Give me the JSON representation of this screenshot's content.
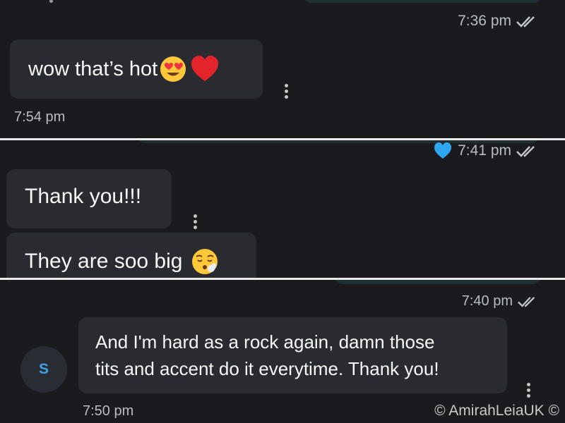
{
  "panel1": {
    "sent_time": "7:36 pm",
    "message": "wow that’s hot",
    "emoji_names": [
      "heart-eyes-emoji",
      "red-heart-emoji"
    ],
    "received_time": "7:54 pm"
  },
  "panel2": {
    "sent_time": "7:41 pm",
    "reaction": "blue-heart-icon",
    "messages": [
      "Thank you!!!",
      "They are soo big"
    ],
    "emoji_names": [
      "exhaling-face-emoji"
    ]
  },
  "panel3": {
    "sent_time": "7:40 pm",
    "message_line1": "And I'm hard as a rock again, damn those",
    "message_line2": "tits and accent do it everytime. Thank you!",
    "avatar_letter": "S",
    "received_time": "7:50 pm",
    "watermark": "© AmirahLeiaUK ©"
  },
  "colors": {
    "background": "#1b1b1f",
    "bubble": "#2a2b30",
    "timestamp": "#b9bcc1",
    "accent_blue": "#3aa0ea",
    "divider": "#eaeaea"
  }
}
